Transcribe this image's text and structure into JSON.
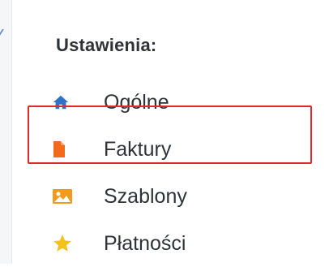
{
  "left_strip": {
    "clipped_text": "Y"
  },
  "settings": {
    "title": "Ustawienia:",
    "items": [
      {
        "label": "Ogólne",
        "icon": "home-icon",
        "icon_color": "#2f72c7"
      },
      {
        "label": "Faktury",
        "icon": "document-icon",
        "icon_color": "#f26a1b"
      },
      {
        "label": "Szablony",
        "icon": "image-icon",
        "icon_color": "#f29a1b"
      },
      {
        "label": "Płatności",
        "icon": "star-icon",
        "icon_color": "#f2c21b"
      }
    ]
  },
  "highlight": {
    "color": "#dd2a2a",
    "target": "Faktury"
  }
}
